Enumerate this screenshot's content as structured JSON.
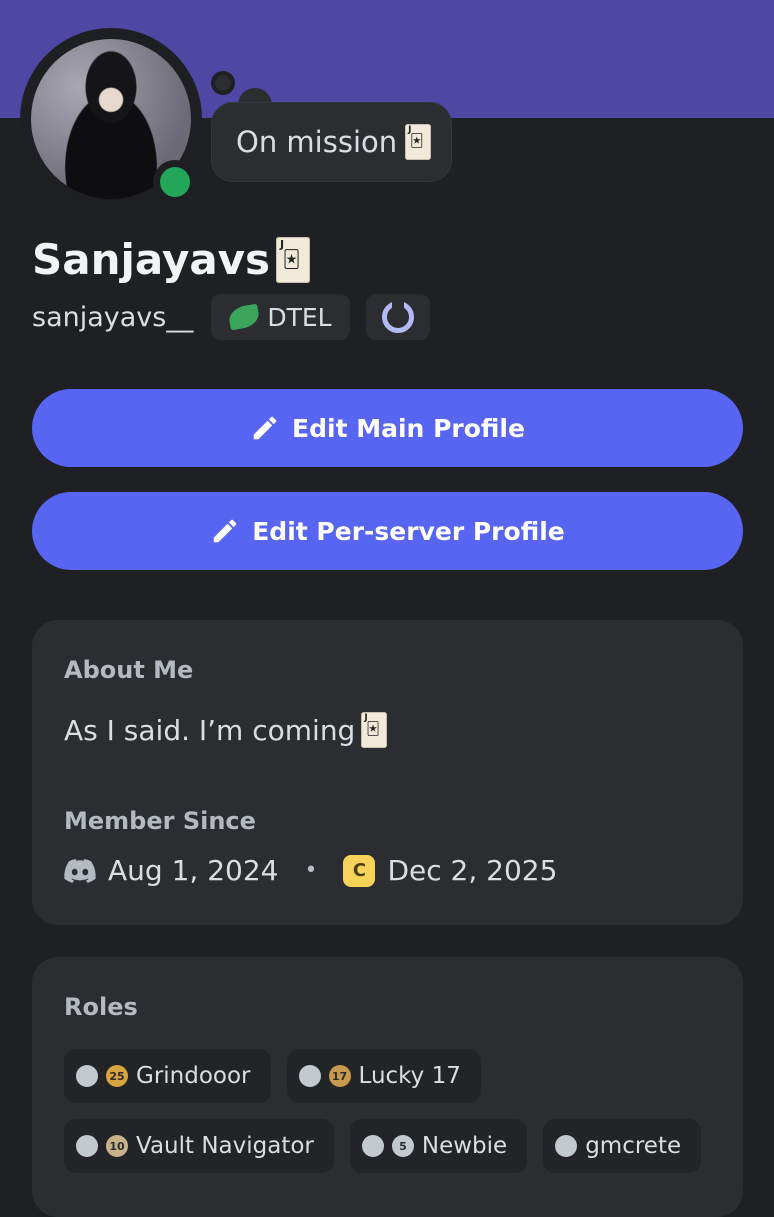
{
  "profile": {
    "display_name": "Sanjayavs",
    "username": "sanjayavs__",
    "status_text": "On mission",
    "status_color": "#23a55a",
    "banner_color": "#5046a3",
    "tags": {
      "clan_label": "DTEL"
    }
  },
  "actions": {
    "edit_main": "Edit Main Profile",
    "edit_server": "Edit Per-server Profile",
    "accent": "#5865f2"
  },
  "about": {
    "heading": "About Me",
    "text": "As I said. I’m coming",
    "member_since_heading": "Member Since",
    "discord_date": "Aug 1, 2024",
    "separator": "•",
    "server_icon_letter": "C",
    "server_date": "Dec 2, 2025"
  },
  "roles": {
    "heading": "Roles",
    "items": [
      {
        "badge": "25",
        "badge_color": "#d9a441",
        "label": "Grindooor"
      },
      {
        "badge": "17",
        "badge_color": "#c89a4e",
        "label": "Lucky 17"
      },
      {
        "badge": "10",
        "badge_color": "#c9b28a",
        "label": "Vault Navigator"
      },
      {
        "badge": "5",
        "badge_color": "#c4c9ce",
        "label": "Newbie"
      },
      {
        "badge": "",
        "badge_color": "",
        "label": "gmcrete"
      }
    ]
  }
}
